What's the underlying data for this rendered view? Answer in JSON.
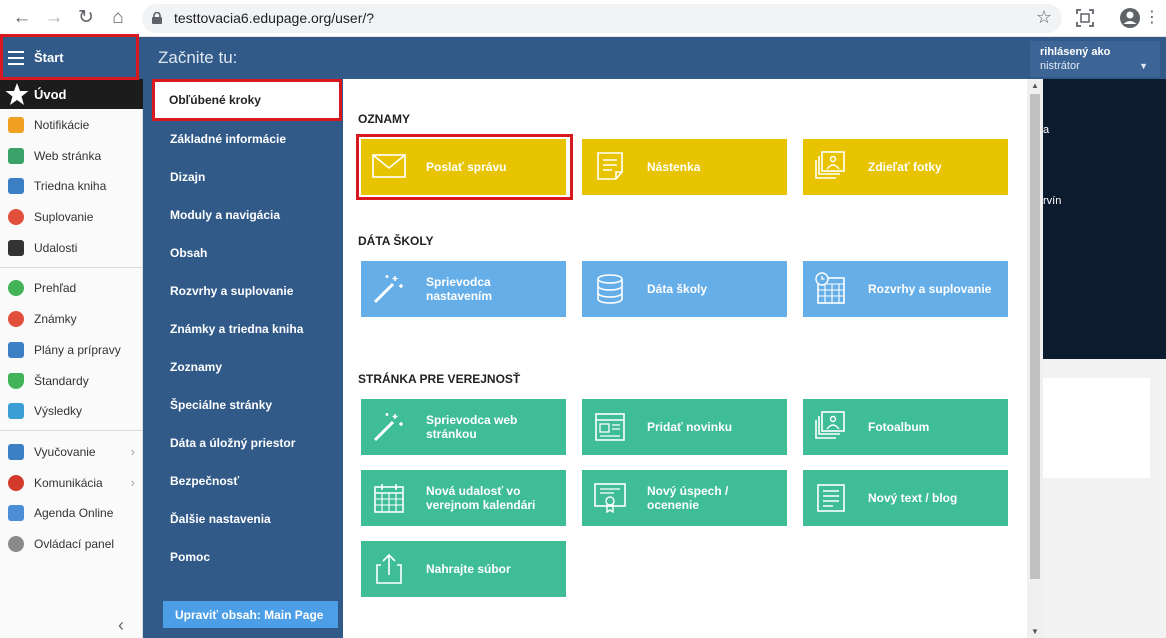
{
  "browser": {
    "url": "testtovacia6.edupage.org/user/?"
  },
  "sidebar": {
    "title": "Štart",
    "active": "Úvod",
    "items": [
      {
        "label": "Notifikácie",
        "color": "#f0a020"
      },
      {
        "label": "Web stránka",
        "color": "#3aa36a"
      },
      {
        "label": "Triedna kniha",
        "color": "#3b7fc4"
      },
      {
        "label": "Suplovanie",
        "color": "#e0503a"
      },
      {
        "label": "Udalosti",
        "color": "#333333"
      },
      {
        "label": "Prehľad",
        "color": "#43b35a"
      },
      {
        "label": "Známky",
        "color": "#e0503a"
      },
      {
        "label": "Plány a prípravy",
        "color": "#3b7fc4"
      },
      {
        "label": "Štandardy",
        "color": "#43b35a"
      },
      {
        "label": "Výsledky",
        "color": "#3b9fd4"
      },
      {
        "label": "Vyučovanie",
        "color": "#3b7fc4"
      },
      {
        "label": "Komunikácia",
        "color": "#d23a2a"
      },
      {
        "label": "Agenda Online",
        "color": "#4c8ed6"
      },
      {
        "label": "Ovládací panel",
        "color": "#8a8a8a"
      }
    ]
  },
  "header": {
    "title": "Začnite tu:",
    "user_line1": "rihlásený ako",
    "user_line2": "nistrátor"
  },
  "menu": {
    "favorite": "Obľúbené kroky",
    "items": [
      "Základné informácie",
      "Dizajn",
      "Moduly a navigácia",
      "Obsah",
      "Rozvrhy a suplovanie",
      "Známky a triedna kniha",
      "Zoznamy",
      "Špeciálne stránky",
      "Dáta a úložný priestor",
      "Bezpečnosť",
      "Ďalšie nastavenia",
      "Pomoc"
    ],
    "edit_button": "Upraviť obsah: Main Page"
  },
  "sections": {
    "oznamy": {
      "title": "OZNAMY",
      "tiles": [
        "Poslať správu",
        "Nástenka",
        "Zdieľať fotky"
      ]
    },
    "data": {
      "title": "DÁTA ŠKOLY",
      "tiles": [
        "Sprievodca nastavením",
        "Dáta školy",
        "Rozvrhy a suplovanie"
      ]
    },
    "public": {
      "title": "STRÁNKA PRE VEREJNOSŤ",
      "tiles": [
        "Sprievodca web stránkou",
        "Pridať novinku",
        "Fotoalbum",
        "Nová udalosť vo verejnom kalendári",
        "Nový úspech / ocenenie",
        "Nový text / blog",
        "Nahrajte súbor"
      ]
    }
  },
  "right_fragments": [
    "a",
    "rvín"
  ],
  "colors": {
    "header_blue": "#315a89",
    "tile_yellow": "#e8c300",
    "tile_blue": "#66aee8",
    "tile_green": "#3fbd96",
    "highlight_red": "#d7191f"
  }
}
